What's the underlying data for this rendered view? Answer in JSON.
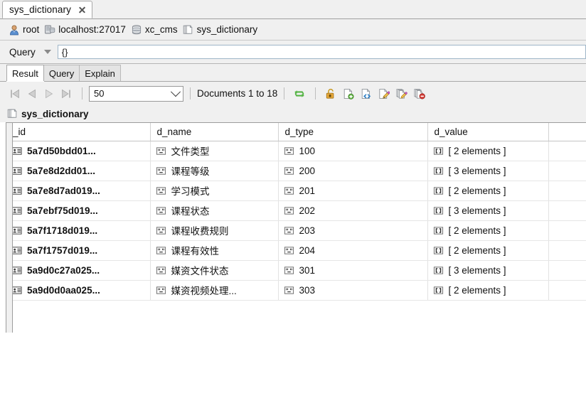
{
  "editor_tab": {
    "title": "sys_dictionary",
    "close_label": "✕"
  },
  "breadcrumb": {
    "items": [
      {
        "icon": "user-icon",
        "label": "root"
      },
      {
        "icon": "server-icon",
        "label": "localhost:27017"
      },
      {
        "icon": "database-icon",
        "label": "xc_cms"
      },
      {
        "icon": "collection-icon",
        "label": "sys_dictionary"
      }
    ]
  },
  "query_bar": {
    "label": "Query",
    "caret_icon": "chevron-down-icon",
    "value": "{}",
    "placeholder": ""
  },
  "inner_tabs": [
    {
      "label": "Result",
      "active": true
    },
    {
      "label": "Query",
      "active": false
    },
    {
      "label": "Explain",
      "active": false
    }
  ],
  "result_toolbar": {
    "nav": [
      {
        "name": "first-page-button",
        "icon": "first-page-icon"
      },
      {
        "name": "previous-page-button",
        "icon": "previous-page-icon"
      },
      {
        "name": "next-page-button",
        "icon": "next-page-icon"
      },
      {
        "name": "last-page-button",
        "icon": "last-page-icon"
      }
    ],
    "page_size": "50",
    "page_size_caret": "chevron-down-icon",
    "documents_label": "Documents 1 to 18",
    "actions": [
      {
        "name": "refresh-button",
        "icon": "refresh-icon"
      },
      {
        "name": "unlock-document-button",
        "icon": "unlock-icon"
      },
      {
        "name": "add-document-button",
        "icon": "new-document-icon"
      },
      {
        "name": "view-document-json-button",
        "icon": "document-code-icon"
      },
      {
        "name": "edit-document-button",
        "icon": "edit-document-icon"
      },
      {
        "name": "edit-documents-button",
        "icon": "edit-documents-icon"
      },
      {
        "name": "delete-documents-button",
        "icon": "delete-documents-icon"
      }
    ]
  },
  "collection": {
    "icon": "collection-icon",
    "name": "sys_dictionary"
  },
  "table": {
    "columns": [
      "_id",
      "d_name",
      "d_type",
      "d_value",
      ""
    ],
    "rows": [
      {
        "id": "5a7d50bdd01...",
        "d_name": "文件类型",
        "d_type": "100",
        "d_value": "[ 2 elements ]"
      },
      {
        "id": "5a7e8d2dd01...",
        "d_name": "课程等级",
        "d_type": "200",
        "d_value": "[ 3 elements ]"
      },
      {
        "id": "5a7e8d7ad019...",
        "d_name": "学习模式",
        "d_type": "201",
        "d_value": "[ 2 elements ]"
      },
      {
        "id": "5a7ebf75d019...",
        "d_name": "课程状态",
        "d_type": "202",
        "d_value": "[ 3 elements ]"
      },
      {
        "id": "5a7f1718d019...",
        "d_name": "课程收费规则",
        "d_type": "203",
        "d_value": "[ 2 elements ]"
      },
      {
        "id": "5a7f1757d019...",
        "d_name": "课程有效性",
        "d_type": "204",
        "d_value": "[ 2 elements ]"
      },
      {
        "id": "5a9d0c27a025...",
        "d_name": "媒资文件状态",
        "d_type": "301",
        "d_value": "[ 3 elements ]"
      },
      {
        "id": "5a9d0d0aa025...",
        "d_name": "媒资视频处理...",
        "d_type": "303",
        "d_value": "[ 2 elements ]"
      }
    ],
    "row_icons": {
      "id": "objectid-icon",
      "string": "string-type-icon",
      "array": "array-type-icon"
    }
  },
  "colors": {
    "window_bg": "#f0f0f0",
    "grid_bg": "#ffffff",
    "border": "#9d9d9d",
    "accent_green": "#4fae3f",
    "accent_orange": "#e8a33d",
    "accent_red": "#d4393a",
    "accent_blue": "#3f80c8"
  }
}
